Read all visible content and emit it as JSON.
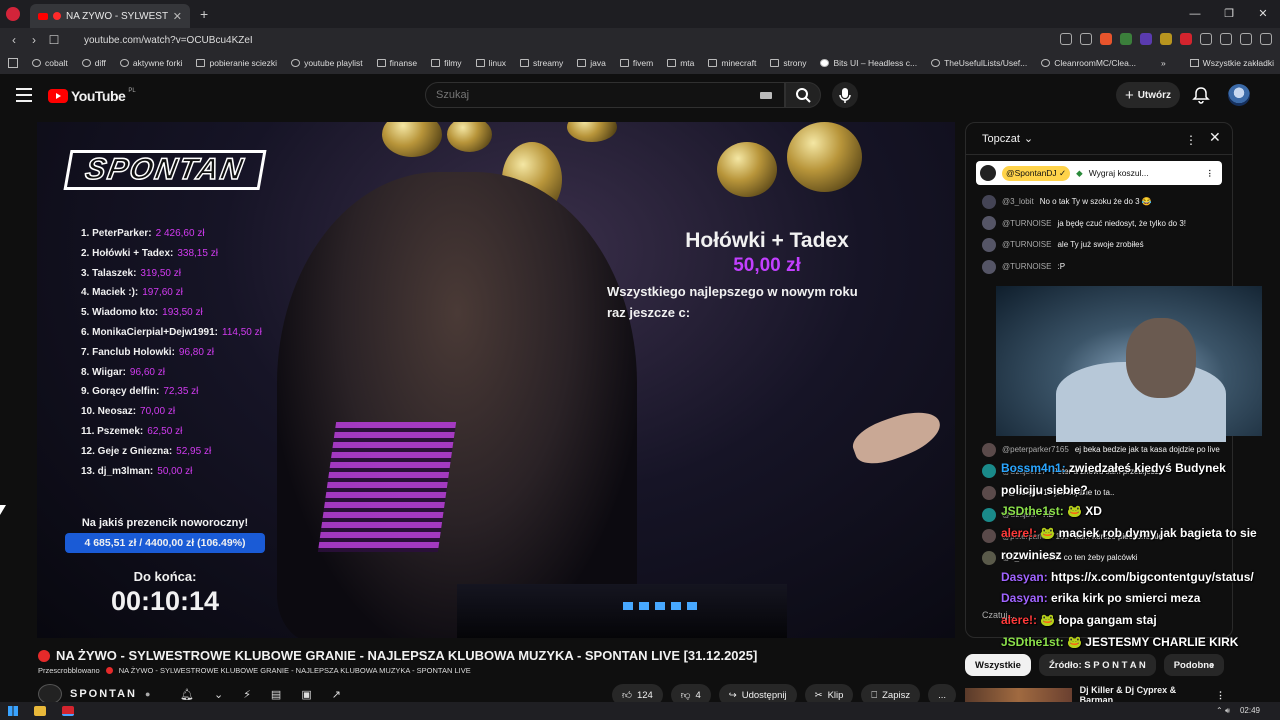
{
  "browser": {
    "tab_title": "NA ŻYWO - SYLWESTROWE",
    "url": "youtube.com/watch?v=OCUBcu4KZeI",
    "bookmarks": [
      "cobalt",
      "diff",
      "aktywne forki",
      "pobieranie sciezki",
      "youtube playlist",
      "finanse",
      "filmy",
      "linux",
      "streamy",
      "java",
      "fivem",
      "mta",
      "minecraft",
      "strony",
      "Bits UI – Headless c...",
      "TheUsefulLists/Usef...",
      "CleanroomMC/Clea..."
    ],
    "bookmarks_more": "Wszystkie zakładki",
    "window_controls": [
      "—",
      "❐",
      "✕"
    ]
  },
  "youtube": {
    "logo": "YouTube",
    "region": "PL",
    "search_placeholder": "Szukaj",
    "create_label": "Utwórz"
  },
  "stream_overlay": {
    "channel_logo": "SPONTAN",
    "leaderboard": [
      {
        "name": "1. PeterParker:",
        "amount": "2 426,60 zł"
      },
      {
        "name": "2. Hołówki + Tadex:",
        "amount": "338,15 zł"
      },
      {
        "name": "3. Talaszek:",
        "amount": "319,50 zł"
      },
      {
        "name": "4. Maciek :):",
        "amount": "197,60 zł"
      },
      {
        "name": "5. Wiadomo kto:",
        "amount": "193,50 zł"
      },
      {
        "name": "6. MonikaCierpial+Dejw1991:",
        "amount": "114,50 zł"
      },
      {
        "name": "7. Fanclub Holowki:",
        "amount": "96,80 zł"
      },
      {
        "name": "8. Wiigar:",
        "amount": "96,60 zł"
      },
      {
        "name": "9. Gorący delfin:",
        "amount": "72,35 zł"
      },
      {
        "name": "10. Neosaz:",
        "amount": "70,00 zł"
      },
      {
        "name": "11. Pszemek:",
        "amount": "62,50 zł"
      },
      {
        "name": "12. Geje z Gniezna:",
        "amount": "52,95 zł"
      },
      {
        "name": "13. dj_m3lman:",
        "amount": "50,00 zł"
      }
    ],
    "donation": {
      "name": "Hołówki + Tadex",
      "amount": "50,00 zł",
      "message_line1": "Wszystkiego najlepszego w nowym roku",
      "message_line2": "raz jeszcze c:"
    },
    "goal": {
      "label": "Na jakiś prezencik noworoczny!",
      "progress_text": "4 685,51 zł / 4400,00 zł (106.49%)",
      "progress_percent": 106.49,
      "countdown_label": "Do końca:",
      "countdown": "00:10:14"
    }
  },
  "chat": {
    "header": "Topczat",
    "pinned_user": "@SpontanDJ ✓",
    "pinned_text": "Wygraj koszul...",
    "messages": [
      {
        "author": "@3_lobit",
        "text": "No o tak Ty w szoku że do 3 😂"
      },
      {
        "author": "@TURNOISE",
        "text": "ja będę czuć niedosyt, że tylko do 3!"
      },
      {
        "author": "@TURNOISE",
        "text": "ale Ty już swoje zrobiłeś"
      },
      {
        "author": "@TURNOISE",
        "text": ":P"
      }
    ],
    "lower_messages": [
      {
        "author": "@peterparker7165",
        "text": "ej beka bedzie jak ta kasa dojdzie po live"
      },
      {
        "author": "@Szajber17",
        "text": "Peter a znowu sam przebijesz"
      },
      {
        "author": "",
        "text": "@Szajber17 jak dojdzie to ta.."
      },
      {
        "author": "@Szajber",
        "text": "XD"
      },
      {
        "author": "@peterparker7165",
        "text": "kur.. kurcze pieczone ale"
      },
      {
        "author": "@3_lobit",
        "text": "Wiesz co ten żeby palcówki"
      }
    ],
    "input_placeholder": "Czatuj..."
  },
  "stream_chat_overlay": [
    {
      "user": "Bossm4n1:",
      "text": "zwiedzałeś kiedyś Budynek policiju siebie?"
    },
    {
      "user": "JSDthe1st:",
      "text": "🐸 XD"
    },
    {
      "user": "alere!:",
      "text": "🐸 maciek rob dymy jak bagieta to sie rozwiniesz"
    },
    {
      "user": "Dasyan:",
      "text": "https://x.com/bigcontentguy/status/"
    },
    {
      "user": "Dasyan:",
      "text": "erika kirk po smierci meza"
    },
    {
      "user": "alere!:",
      "text": "🐸 łopa gangam staj"
    },
    {
      "user": "JSDthe1st:",
      "text": "🐸 JESTESMY CHARLIE KIRK"
    }
  ],
  "video": {
    "title": "NA ŻYWO - SYLWESTROWE KLUBOWE GRANIE - NAJLEPSZA KLUBOWA MUZYKA - SPONTAN LIVE [31.12.2025]",
    "scrobble_label": "Przescrobblowano",
    "scrobble_title": "NA ŻYWO - SYLWESTROWE KLUBOWE GRANIE - NAJLEPSZA KLUBOWA MUZYKA - SPONTAN LIVE",
    "channel": "SPONTAN",
    "likes": "124",
    "dislikes": "4",
    "share": "Udostępnij",
    "clip": "Klip",
    "save": "Zapisz",
    "more": "..."
  },
  "chips": [
    "Wszystkie",
    "Źródło: S P O N T A N",
    "Podobne"
  ],
  "related_title": "Dj Killer & Dj Cyprex & Barman",
  "clock": "02:49"
}
